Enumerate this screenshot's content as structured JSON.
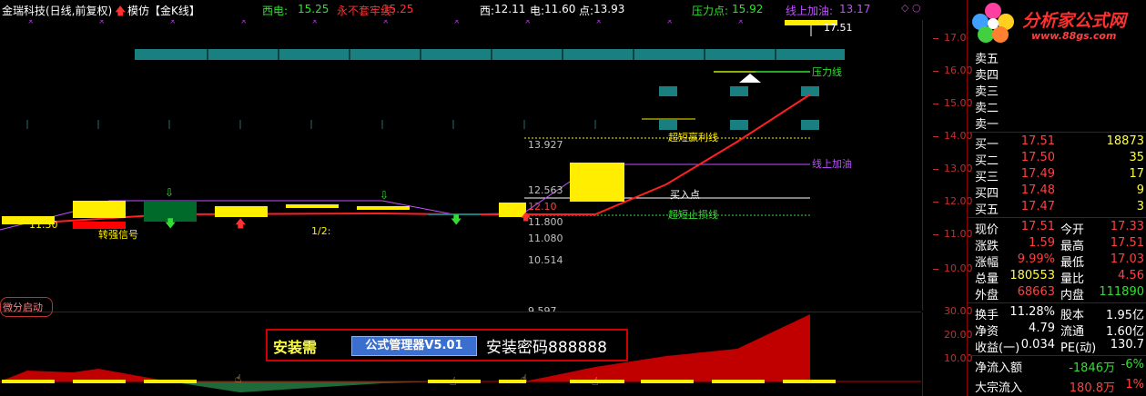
{
  "header": {
    "stock": "金瑞科技(日线,前复权)",
    "arrow_icon": "red-up-arrow",
    "indicator_name": "模仿【金K线】",
    "xidian_label": "西电:",
    "xidian_value": "15.25",
    "stop_label": "永不套牢线:",
    "stop_value": "15.25",
    "xi_label": "西:",
    "xi_value": "12.11",
    "dian_label": "电:",
    "dian_value": "11.60",
    "point_label": "点:",
    "point_value": "13.93",
    "pressure_label": "压力点:",
    "pressure_value": "15.92",
    "add_label": "线上加油:",
    "add_value": "13.17"
  },
  "main_axis": [
    "17.00",
    "16.00",
    "15.00",
    "14.00",
    "13.00",
    "12.00",
    "11.00",
    "10.00"
  ],
  "sub_axis": [
    "30.00",
    "20.00",
    "10.00"
  ],
  "chart_annotations": {
    "pressure_line": "压力线",
    "super_short_profit": "超短赢利线",
    "line_add_oil": "线上加油",
    "buy_point": "买入点",
    "super_short_stop": "超短止损线",
    "strong_signal": "转强信号",
    "half_label": "1/2:",
    "low_value": "11.30",
    "high_value": "17.51",
    "price_levels": [
      "13.927",
      "12.563",
      "12.10",
      "11.800",
      "11.080",
      "10.514",
      "9.597"
    ]
  },
  "colors": {
    "up": "#ff3030",
    "down": "#30c030",
    "candle_yellow": "#ffee00",
    "purple": "#c050ff",
    "teal": "#1a7f80",
    "axis": "#c03030"
  },
  "sub_panel": {
    "label": "微分启动",
    "install_prefix": "安装需",
    "install_button": "公式管理器V5.01",
    "install_password": "安装密码888888"
  },
  "logo": {
    "brand": "分析家公式网",
    "url": "www.88gs.com"
  },
  "quote": {
    "asks": [
      {
        "label": "卖五",
        "price": "",
        "vol": ""
      },
      {
        "label": "卖四",
        "price": "",
        "vol": ""
      },
      {
        "label": "卖三",
        "price": "",
        "vol": ""
      },
      {
        "label": "卖二",
        "price": "",
        "vol": ""
      },
      {
        "label": "卖一",
        "price": "",
        "vol": ""
      }
    ],
    "bids": [
      {
        "label": "买一",
        "price": "17.51",
        "vol": "18873"
      },
      {
        "label": "买二",
        "price": "17.50",
        "vol": "35"
      },
      {
        "label": "买三",
        "price": "17.49",
        "vol": "17"
      },
      {
        "label": "买四",
        "price": "17.48",
        "vol": "9"
      },
      {
        "label": "买五",
        "price": "17.47",
        "vol": "3"
      }
    ],
    "stats": [
      {
        "l1": "现价",
        "v1": "17.51",
        "c1": "red",
        "l2": "今开",
        "v2": "17.33",
        "c2": "red"
      },
      {
        "l1": "涨跌",
        "v1": "1.59",
        "c1": "red",
        "l2": "最高",
        "v2": "17.51",
        "c2": "red"
      },
      {
        "l1": "涨幅",
        "v1": "9.99%",
        "c1": "red",
        "l2": "最低",
        "v2": "17.03",
        "c2": "red"
      },
      {
        "l1": "总量",
        "v1": "180553",
        "c1": "yel",
        "l2": "量比",
        "v2": "4.56",
        "c2": "red"
      },
      {
        "l1": "外盘",
        "v1": "68663",
        "c1": "red",
        "l2": "内盘",
        "v2": "111890",
        "c2": "grn"
      }
    ],
    "stats2": [
      {
        "l1": "换手",
        "v1": "11.28%",
        "l2": "股本",
        "v2": "1.95亿"
      },
      {
        "l1": "净资",
        "v1": "4.79",
        "l2": "流通",
        "v2": "1.60亿"
      },
      {
        "l1": "收益(一)",
        "v1": "0.034",
        "l2": "PE(动)",
        "v2": "130.7"
      }
    ],
    "flows": [
      {
        "label": "净流入额",
        "value": "-1846万",
        "pct": "-6%",
        "color": "grn"
      },
      {
        "label": "大宗流入",
        "value": "180.8万",
        "pct": "1%",
        "color": "red"
      }
    ]
  }
}
